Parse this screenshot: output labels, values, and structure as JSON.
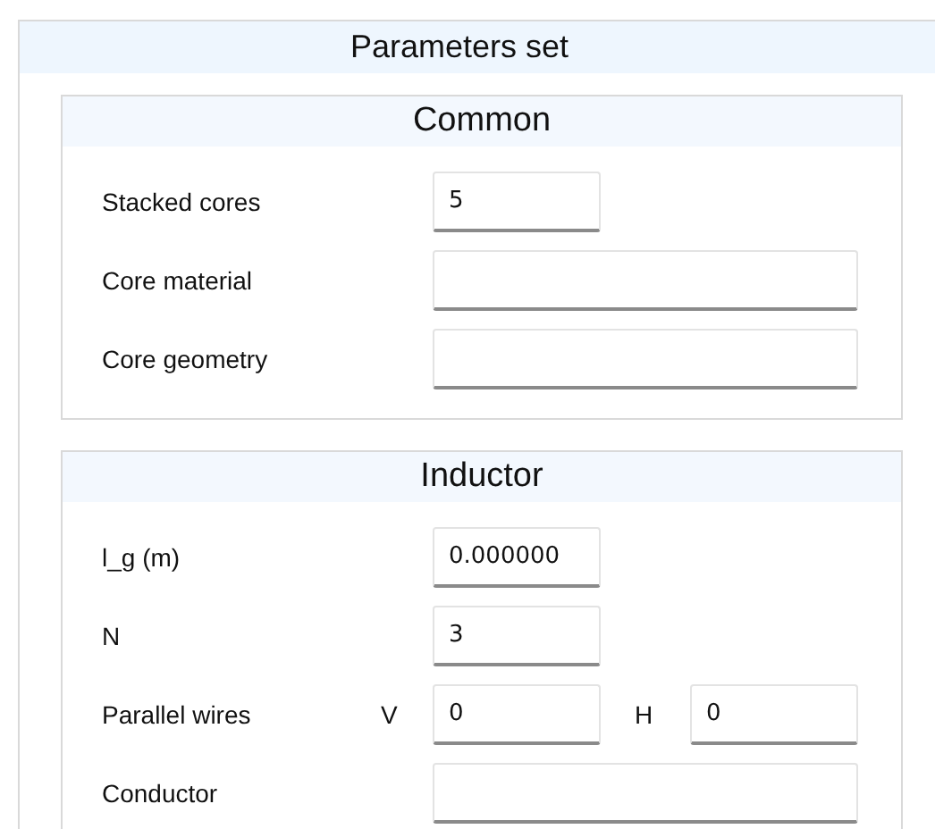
{
  "panel": {
    "title": "Parameters set"
  },
  "sections": [
    {
      "title": "Common",
      "rows": [
        {
          "label": "Stacked cores",
          "fields": [
            {
              "kind": "short",
              "value": "5"
            }
          ]
        },
        {
          "label": "Core material",
          "fields": [
            {
              "kind": "wide"
            }
          ]
        },
        {
          "label": "Core geometry",
          "fields": [
            {
              "kind": "wide"
            }
          ]
        }
      ]
    },
    {
      "title": "Inductor",
      "rows": [
        {
          "label": "l_g (m)",
          "fields": [
            {
              "kind": "short",
              "value": "0.000000"
            }
          ]
        },
        {
          "label": "N",
          "fields": [
            {
              "kind": "short",
              "value": "3"
            }
          ]
        },
        {
          "label": "Parallel wires",
          "fields": [
            {
              "kind": "short",
              "prefix": "V",
              "value": "0"
            },
            {
              "kind": "short",
              "prefix": "H",
              "value": "0"
            }
          ]
        },
        {
          "label": "Conductor",
          "fields": [
            {
              "kind": "wide"
            }
          ]
        }
      ]
    }
  ]
}
